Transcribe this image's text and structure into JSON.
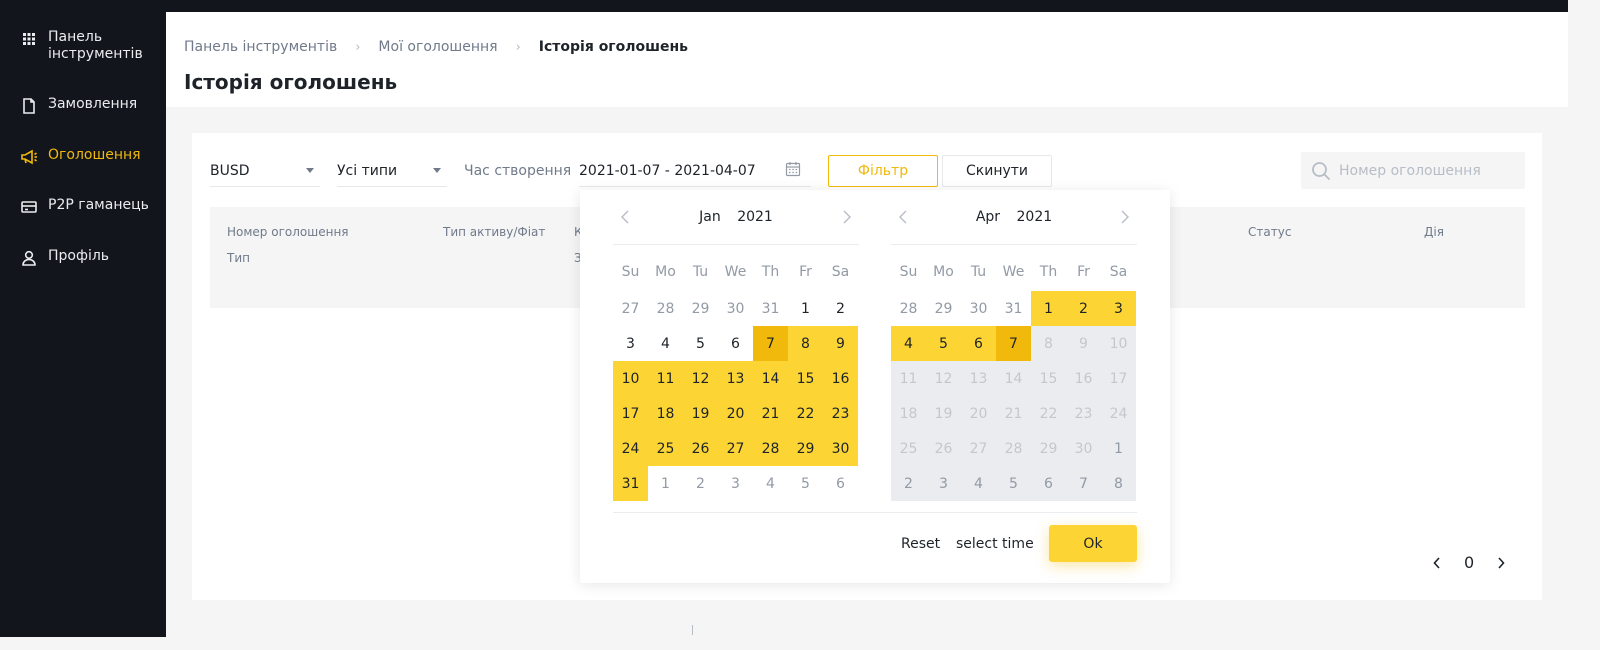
{
  "sidebar": {
    "items": [
      {
        "label": "Панель інструментів",
        "icon": "dashboard-grid-icon"
      },
      {
        "label": "Замовлення",
        "icon": "document-icon"
      },
      {
        "label": "Оголошення",
        "icon": "megaphone-icon",
        "active": true
      },
      {
        "label": "P2P гаманець",
        "icon": "wallet-icon"
      },
      {
        "label": "Профіль",
        "icon": "user-icon"
      }
    ]
  },
  "header": {
    "breadcrumb": [
      "Панель інструментів",
      "Мої оголошення",
      "Історія оголошень"
    ],
    "title": "Історія оголошень"
  },
  "filters": {
    "asset": "BUSD",
    "type": "Усі типи",
    "time_label": "Час створення",
    "date_range": "2021-01-07 - 2021-04-07",
    "filter_button": "Фільтр",
    "reset_button": "Скинути",
    "search_placeholder": "Номер оголошення"
  },
  "table": {
    "headers": {
      "ad_number": "Номер оголошення",
      "type": "Тип",
      "asset_fiat": "Тип активу/Фіат",
      "col3_line1": "К",
      "col3_line2": "З",
      "status": "Статус",
      "action": "Дія"
    }
  },
  "pagination": {
    "page": "0"
  },
  "datepicker": {
    "weekdays": [
      "Su",
      "Mo",
      "Tu",
      "We",
      "Th",
      "Fr",
      "Sa"
    ],
    "left": {
      "month": "Jan",
      "year": "2021",
      "days": [
        [
          "27",
          "out"
        ],
        [
          "28",
          "out"
        ],
        [
          "29",
          "out"
        ],
        [
          "30",
          "out"
        ],
        [
          "31",
          "out"
        ],
        [
          "1",
          ""
        ],
        [
          "2",
          ""
        ],
        [
          "3",
          ""
        ],
        [
          "4",
          ""
        ],
        [
          "5",
          ""
        ],
        [
          "6",
          ""
        ],
        [
          "7",
          "edge"
        ],
        [
          "8",
          "range"
        ],
        [
          "9",
          "range"
        ],
        [
          "10",
          "range"
        ],
        [
          "11",
          "range"
        ],
        [
          "12",
          "range"
        ],
        [
          "13",
          "range"
        ],
        [
          "14",
          "range"
        ],
        [
          "15",
          "range"
        ],
        [
          "16",
          "range"
        ],
        [
          "17",
          "range"
        ],
        [
          "18",
          "range"
        ],
        [
          "19",
          "range"
        ],
        [
          "20",
          "range"
        ],
        [
          "21",
          "range"
        ],
        [
          "22",
          "range"
        ],
        [
          "23",
          "range"
        ],
        [
          "24",
          "range"
        ],
        [
          "25",
          "range"
        ],
        [
          "26",
          "range"
        ],
        [
          "27",
          "range"
        ],
        [
          "28",
          "range"
        ],
        [
          "29",
          "range"
        ],
        [
          "30",
          "range"
        ],
        [
          "31",
          "range"
        ],
        [
          "1",
          "out"
        ],
        [
          "2",
          "out"
        ],
        [
          "3",
          "out"
        ],
        [
          "4",
          "out"
        ],
        [
          "5",
          "out"
        ],
        [
          "6",
          "out"
        ]
      ]
    },
    "right": {
      "month": "Apr",
      "year": "2021",
      "days": [
        [
          "28",
          "out"
        ],
        [
          "29",
          "out"
        ],
        [
          "30",
          "out"
        ],
        [
          "31",
          "out"
        ],
        [
          "1",
          "range"
        ],
        [
          "2",
          "range"
        ],
        [
          "3",
          "range"
        ],
        [
          "4",
          "range"
        ],
        [
          "5",
          "range"
        ],
        [
          "6",
          "range"
        ],
        [
          "7",
          "edge"
        ],
        [
          "8",
          "dis"
        ],
        [
          "9",
          "dis"
        ],
        [
          "10",
          "dis"
        ],
        [
          "11",
          "dis"
        ],
        [
          "12",
          "dis"
        ],
        [
          "13",
          "dis"
        ],
        [
          "14",
          "dis"
        ],
        [
          "15",
          "dis"
        ],
        [
          "16",
          "dis"
        ],
        [
          "17",
          "dis"
        ],
        [
          "18",
          "dis"
        ],
        [
          "19",
          "dis"
        ],
        [
          "20",
          "dis"
        ],
        [
          "21",
          "dis"
        ],
        [
          "22",
          "dis"
        ],
        [
          "23",
          "dis"
        ],
        [
          "24",
          "dis"
        ],
        [
          "25",
          "dis"
        ],
        [
          "26",
          "dis"
        ],
        [
          "27",
          "dis"
        ],
        [
          "28",
          "dis"
        ],
        [
          "29",
          "dis"
        ],
        [
          "30",
          "dis"
        ],
        [
          "1",
          "dis-out"
        ],
        [
          "2",
          "dis-out"
        ],
        [
          "3",
          "dis-out"
        ],
        [
          "4",
          "dis-out"
        ],
        [
          "5",
          "dis-out"
        ],
        [
          "6",
          "dis-out"
        ],
        [
          "7",
          "dis-out"
        ],
        [
          "8",
          "dis-out"
        ]
      ]
    },
    "reset_label": "Reset",
    "select_time_label": "select time",
    "ok_label": "Ok"
  },
  "colors": {
    "sidebar_bg": "#12161c",
    "accent": "#f0b90b",
    "range": "#fcd535",
    "disabled_bg": "#eaecef"
  }
}
